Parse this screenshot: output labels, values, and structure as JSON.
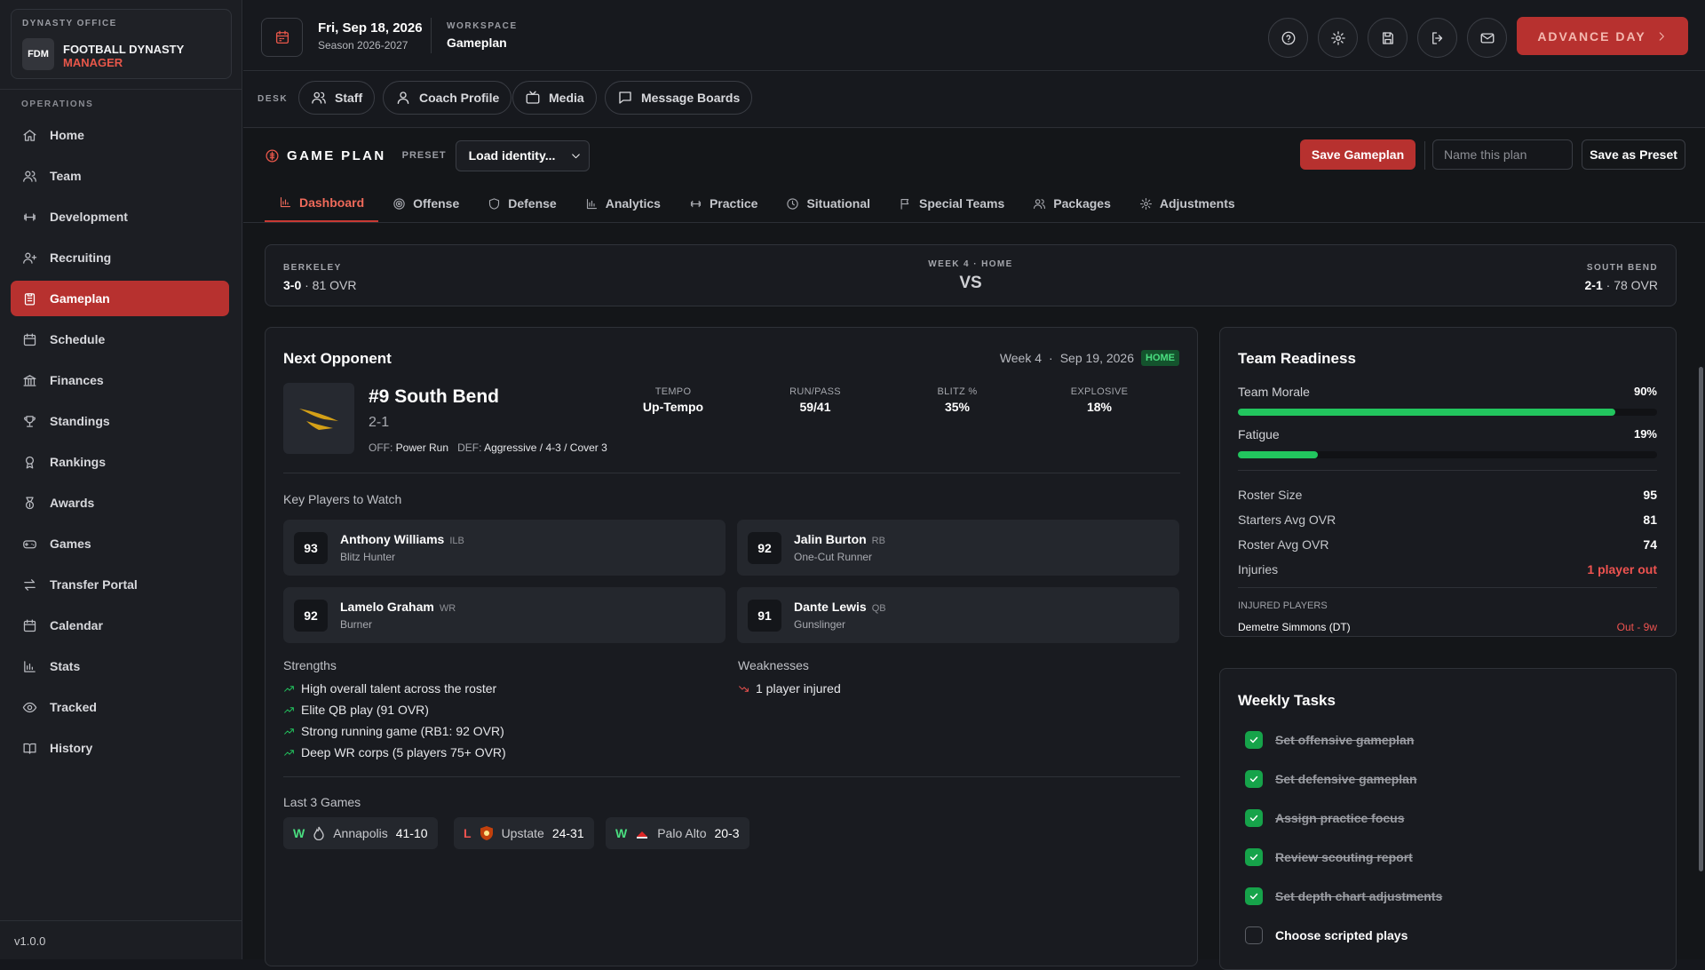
{
  "sidebar": {
    "office_label": "DYNASTY OFFICE",
    "logo_text": "FDM",
    "title_line1": "FOOTBALL DYNASTY",
    "title_line2": "MANAGER",
    "section_label": "OPERATIONS",
    "items": [
      {
        "label": "Home",
        "icon": "home-icon"
      },
      {
        "label": "Team",
        "icon": "users-icon"
      },
      {
        "label": "Development",
        "icon": "dumbbell-icon"
      },
      {
        "label": "Recruiting",
        "icon": "user-plus-icon"
      },
      {
        "label": "Gameplan",
        "icon": "clipboard-icon",
        "active": true
      },
      {
        "label": "Schedule",
        "icon": "calendar-icon"
      },
      {
        "label": "Finances",
        "icon": "bank-icon"
      },
      {
        "label": "Standings",
        "icon": "trophy-icon"
      },
      {
        "label": "Rankings",
        "icon": "award-icon"
      },
      {
        "label": "Awards",
        "icon": "medal-icon"
      },
      {
        "label": "Games",
        "icon": "gamepad-icon"
      },
      {
        "label": "Transfer Portal",
        "icon": "transfer-icon"
      },
      {
        "label": "Calendar",
        "icon": "calendar-icon"
      },
      {
        "label": "Stats",
        "icon": "bar-chart-icon"
      },
      {
        "label": "Tracked",
        "icon": "eye-icon"
      },
      {
        "label": "History",
        "icon": "book-icon"
      }
    ],
    "version": "v1.0.0"
  },
  "header": {
    "date": "Fri, Sep 18, 2026",
    "season": "Season 2026-2027",
    "workspace_label": "WORKSPACE",
    "workspace_value": "Gameplan",
    "icons": [
      "help-icon",
      "settings-icon",
      "save-icon",
      "logout-icon",
      "mail-icon"
    ],
    "advance_label": "ADVANCE DAY"
  },
  "desk": {
    "label": "DESK",
    "buttons": [
      {
        "label": "Staff",
        "icon": "users-icon"
      },
      {
        "label": "Coach Profile",
        "icon": "user-icon"
      },
      {
        "label": "Media",
        "icon": "tv-icon"
      },
      {
        "label": "Message Boards",
        "icon": "message-icon"
      }
    ]
  },
  "gameplan": {
    "title": "GAME PLAN",
    "preset_label": "PRESET",
    "preset_value": "Load identity...",
    "save_label": "Save Gameplan",
    "plan_name_placeholder": "Name this plan",
    "save_preset_label": "Save as Preset",
    "tabs": [
      {
        "label": "Dashboard",
        "icon": "bar-chart-icon",
        "active": true
      },
      {
        "label": "Offense",
        "icon": "target-icon"
      },
      {
        "label": "Defense",
        "icon": "shield-icon"
      },
      {
        "label": "Analytics",
        "icon": "analytics-icon"
      },
      {
        "label": "Practice",
        "icon": "dumbbell-icon"
      },
      {
        "label": "Situational",
        "icon": "clock-icon"
      },
      {
        "label": "Special Teams",
        "icon": "flag-icon"
      },
      {
        "label": "Packages",
        "icon": "users-icon"
      },
      {
        "label": "Adjustments",
        "icon": "gear-icon"
      }
    ]
  },
  "matchup": {
    "home_team": "BERKELEY",
    "home_record": "3-0",
    "home_ovr": "· 81 OVR",
    "week_label": "WEEK 4 · HOME",
    "vs": "VS",
    "away_team": "SOUTH BEND",
    "away_record": "2-1",
    "away_ovr": "· 78 OVR"
  },
  "opponent": {
    "card_title": "Next Opponent",
    "week": "Week 4",
    "dot": "·",
    "date": "Sep 19, 2026",
    "badge": "HOME",
    "name": "#9 South Bend",
    "record": "2-1",
    "off_label": "OFF:",
    "off_value": "Power Run",
    "def_label": "DEF:",
    "def_value": "Aggressive / 4-3 / Cover 3",
    "stats": [
      {
        "label": "TEMPO",
        "value": "Up-Tempo"
      },
      {
        "label": "RUN/PASS",
        "value": "59/41"
      },
      {
        "label": "BLITZ %",
        "value": "35%"
      },
      {
        "label": "EXPLOSIVE",
        "value": "18%"
      }
    ],
    "key_players_label": "Key Players to Watch",
    "players": [
      {
        "ovr": "93",
        "name": "Anthony Williams",
        "pos": "ILB",
        "trait": "Blitz Hunter"
      },
      {
        "ovr": "92",
        "name": "Jalin Burton",
        "pos": "RB",
        "trait": "One-Cut Runner"
      },
      {
        "ovr": "92",
        "name": "Lamelo Graham",
        "pos": "WR",
        "trait": "Burner"
      },
      {
        "ovr": "91",
        "name": "Dante Lewis",
        "pos": "QB",
        "trait": "Gunslinger"
      }
    ],
    "strengths_label": "Strengths",
    "strengths": [
      "High overall talent across the roster",
      "Elite QB play (91 OVR)",
      "Strong running game (RB1: 92 OVR)",
      "Deep WR corps (5 players 75+ OVR)"
    ],
    "weaknesses_label": "Weaknesses",
    "weaknesses": [
      "1 player injured"
    ],
    "last_games_label": "Last 3 Games",
    "last_games": [
      {
        "result": "W",
        "team": "Annapolis",
        "score": "41-10"
      },
      {
        "result": "L",
        "team": "Upstate",
        "score": "24-31"
      },
      {
        "result": "W",
        "team": "Palo Alto",
        "score": "20-3"
      }
    ]
  },
  "readiness": {
    "title": "Team Readiness",
    "morale_label": "Team Morale",
    "morale_value": "90%",
    "morale_pct": 90,
    "fatigue_label": "Fatigue",
    "fatigue_value": "19%",
    "fatigue_pct": 19,
    "rows": [
      {
        "label": "Roster Size",
        "value": "95"
      },
      {
        "label": "Starters Avg OVR",
        "value": "81"
      },
      {
        "label": "Roster Avg OVR",
        "value": "74"
      },
      {
        "label": "Injuries",
        "value": "1 player out"
      }
    ],
    "injured_label": "INJURED PLAYERS",
    "injured_player": "Demetre Simmons (DT)",
    "injured_status": "Out - 9w"
  },
  "tasks": {
    "title": "Weekly Tasks",
    "items": [
      {
        "label": "Set offensive gameplan",
        "done": true
      },
      {
        "label": "Set defensive gameplan",
        "done": true
      },
      {
        "label": "Assign practice focus",
        "done": true
      },
      {
        "label": "Review scouting report",
        "done": true
      },
      {
        "label": "Set depth chart adjustments",
        "done": true
      },
      {
        "label": "Choose scripted plays",
        "done": false
      }
    ]
  },
  "colors": {
    "accent": "#b7312f",
    "success": "#22c55e",
    "danger": "#ef5350"
  }
}
